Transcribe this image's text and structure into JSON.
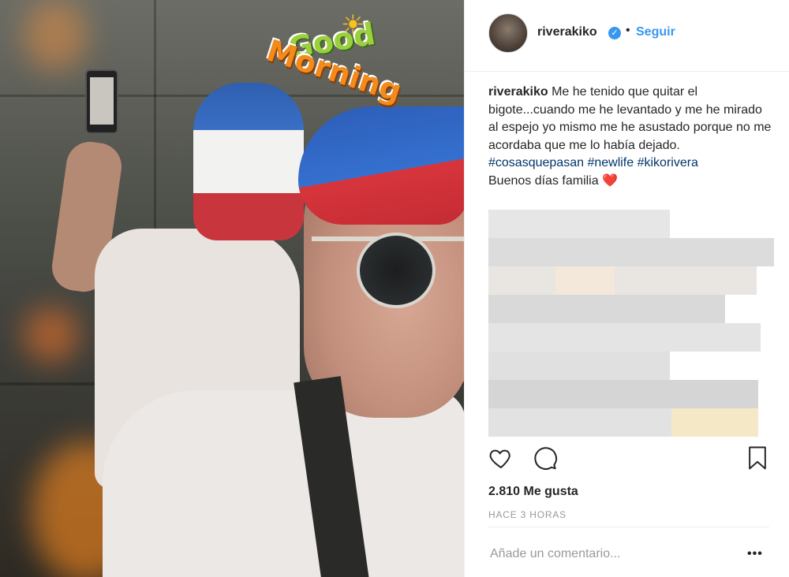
{
  "post": {
    "username": "riverakiko",
    "follow_label": "Seguir",
    "separator": "•",
    "verified_glyph": "✓",
    "sticker": {
      "line1": "Good",
      "line2": "Morning",
      "sun_icon": "sun-icon"
    },
    "caption": {
      "author": "riverakiko",
      "text": "Me he tenido que quitar el bigote...cuando me he levantado y me he mirado al espejo yo mismo me he asustado porque no me acordaba que me lo había dejado.",
      "hashtags": [
        "#cosasquepasan",
        "#newlife",
        "#kikorivera"
      ],
      "closing": "Buenos días familia",
      "emoji": "❤️"
    },
    "likes": "2.810 Me gusta",
    "time": "HACE 3 HORAS",
    "comment_placeholder": "Añade un comentario...",
    "more_label": "•••",
    "icons": {
      "like": "heart-icon",
      "comment": "comment-icon",
      "save": "bookmark-icon"
    },
    "colors": {
      "link": "#3897f0",
      "hashtag": "#003569",
      "text": "#262626",
      "muted": "#999999"
    }
  }
}
